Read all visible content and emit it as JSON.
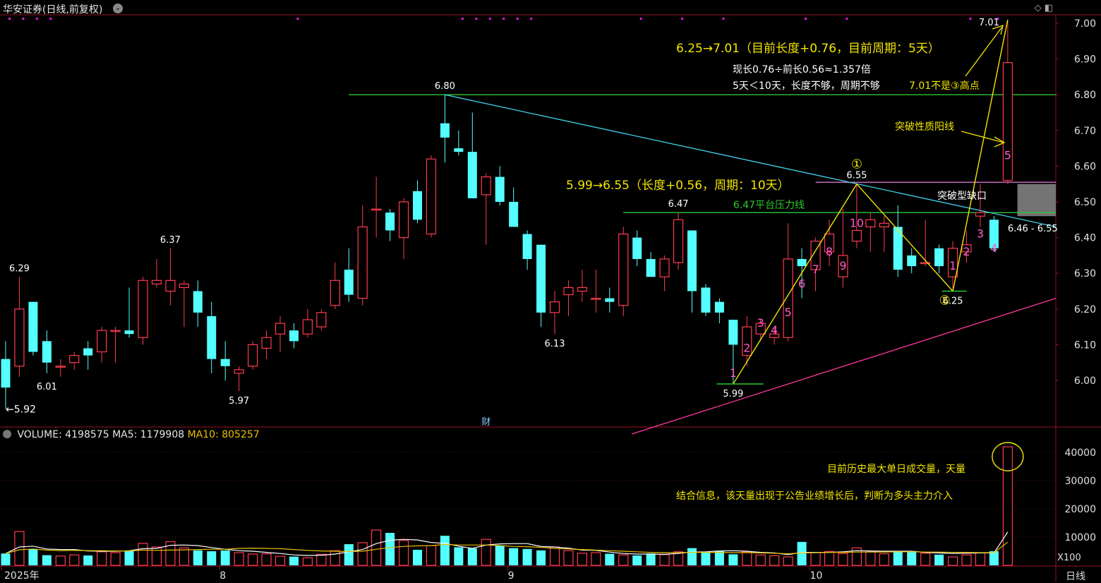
{
  "header": {
    "title": "华安证券(日线,前复权)",
    "menu_icon": "chevron-down-icon",
    "window_icons": [
      "diamond-icon",
      "panel-icon"
    ]
  },
  "colors": {
    "up": "#ff3b52",
    "down": "#54ffff",
    "axis": "#9a0f24",
    "price_label": "#ffffff",
    "annotation_yellow": "#f2e600",
    "count_pink": "#ff5cc8",
    "green_line": "#2ec82e",
    "cyan_line": "#3fd2ec",
    "magenta_line": "#ff3a9c"
  },
  "chart_data": [
    {
      "type": "candlestick",
      "title": "华安证券(日线,前复权)",
      "ylim": [
        5.86,
        7.04
      ],
      "y_ticks": [
        6.0,
        6.1,
        6.2,
        6.3,
        6.4,
        6.5,
        6.6,
        6.7,
        6.8,
        6.9,
        7.0
      ],
      "x_labels": [
        "2025年",
        "8",
        "9",
        "10"
      ],
      "candles": [
        {
          "o": 6.06,
          "h": 6.11,
          "l": 5.92,
          "c": 5.98
        },
        {
          "o": 6.04,
          "h": 6.29,
          "l": 6.01,
          "c": 6.2
        },
        {
          "o": 6.22,
          "h": 6.22,
          "l": 6.07,
          "c": 6.08
        },
        {
          "o": 6.11,
          "h": 6.14,
          "l": 6.02,
          "c": 6.05
        },
        {
          "o": 6.04,
          "h": 6.06,
          "l": 6.01,
          "c": 6.04
        },
        {
          "o": 6.05,
          "h": 6.08,
          "l": 6.03,
          "c": 6.07
        },
        {
          "o": 6.09,
          "h": 6.11,
          "l": 6.03,
          "c": 6.07
        },
        {
          "o": 6.08,
          "h": 6.15,
          "l": 6.05,
          "c": 6.14
        },
        {
          "o": 6.14,
          "h": 6.15,
          "l": 6.05,
          "c": 6.14
        },
        {
          "o": 6.14,
          "h": 6.26,
          "l": 6.12,
          "c": 6.13
        },
        {
          "o": 6.12,
          "h": 6.29,
          "l": 6.1,
          "c": 6.28
        },
        {
          "o": 6.27,
          "h": 6.34,
          "l": 6.26,
          "c": 6.28
        },
        {
          "o": 6.25,
          "h": 6.37,
          "l": 6.21,
          "c": 6.28
        },
        {
          "o": 6.26,
          "h": 6.28,
          "l": 6.15,
          "c": 6.27
        },
        {
          "o": 6.25,
          "h": 6.28,
          "l": 6.15,
          "c": 6.19
        },
        {
          "o": 6.18,
          "h": 6.22,
          "l": 6.02,
          "c": 6.06
        },
        {
          "o": 6.06,
          "h": 6.11,
          "l": 6.0,
          "c": 6.04
        },
        {
          "o": 6.02,
          "h": 6.04,
          "l": 5.97,
          "c": 6.03
        },
        {
          "o": 6.04,
          "h": 6.11,
          "l": 6.03,
          "c": 6.1
        },
        {
          "o": 6.09,
          "h": 6.14,
          "l": 6.06,
          "c": 6.12
        },
        {
          "o": 6.13,
          "h": 6.18,
          "l": 6.08,
          "c": 6.16
        },
        {
          "o": 6.14,
          "h": 6.16,
          "l": 6.09,
          "c": 6.11
        },
        {
          "o": 6.13,
          "h": 6.2,
          "l": 6.12,
          "c": 6.17
        },
        {
          "o": 6.15,
          "h": 6.2,
          "l": 6.14,
          "c": 6.19
        },
        {
          "o": 6.21,
          "h": 6.33,
          "l": 6.2,
          "c": 6.28
        },
        {
          "o": 6.31,
          "h": 6.37,
          "l": 6.22,
          "c": 6.24
        },
        {
          "o": 6.23,
          "h": 6.49,
          "l": 6.21,
          "c": 6.43
        },
        {
          "o": 6.48,
          "h": 6.57,
          "l": 6.4,
          "c": 6.48
        },
        {
          "o": 6.47,
          "h": 6.48,
          "l": 6.39,
          "c": 6.42
        },
        {
          "o": 6.4,
          "h": 6.51,
          "l": 6.34,
          "c": 6.5
        },
        {
          "o": 6.53,
          "h": 6.56,
          "l": 6.44,
          "c": 6.45
        },
        {
          "o": 6.41,
          "h": 6.63,
          "l": 6.4,
          "c": 6.62
        },
        {
          "o": 6.72,
          "h": 6.8,
          "l": 6.61,
          "c": 6.68
        },
        {
          "o": 6.65,
          "h": 6.7,
          "l": 6.63,
          "c": 6.64
        },
        {
          "o": 6.64,
          "h": 6.75,
          "l": 6.51,
          "c": 6.51
        },
        {
          "o": 6.52,
          "h": 6.58,
          "l": 6.38,
          "c": 6.57
        },
        {
          "o": 6.57,
          "h": 6.6,
          "l": 6.49,
          "c": 6.5
        },
        {
          "o": 6.5,
          "h": 6.54,
          "l": 6.43,
          "c": 6.43
        },
        {
          "o": 6.41,
          "h": 6.42,
          "l": 6.31,
          "c": 6.34
        },
        {
          "o": 6.38,
          "h": 6.38,
          "l": 6.15,
          "c": 6.19
        },
        {
          "o": 6.19,
          "h": 6.25,
          "l": 6.13,
          "c": 6.22
        },
        {
          "o": 6.24,
          "h": 6.28,
          "l": 6.18,
          "c": 6.26
        },
        {
          "o": 6.25,
          "h": 6.31,
          "l": 6.22,
          "c": 6.26
        },
        {
          "o": 6.23,
          "h": 6.31,
          "l": 6.19,
          "c": 6.23
        },
        {
          "o": 6.23,
          "h": 6.26,
          "l": 6.19,
          "c": 6.22
        },
        {
          "o": 6.21,
          "h": 6.43,
          "l": 6.18,
          "c": 6.41
        },
        {
          "o": 6.4,
          "h": 6.42,
          "l": 6.32,
          "c": 6.34
        },
        {
          "o": 6.34,
          "h": 6.36,
          "l": 6.29,
          "c": 6.29
        },
        {
          "o": 6.29,
          "h": 6.35,
          "l": 6.25,
          "c": 6.34
        },
        {
          "o": 6.33,
          "h": 6.47,
          "l": 6.31,
          "c": 6.45
        },
        {
          "o": 6.42,
          "h": 6.42,
          "l": 6.19,
          "c": 6.25
        },
        {
          "o": 6.26,
          "h": 6.27,
          "l": 6.18,
          "c": 6.19
        },
        {
          "o": 6.22,
          "h": 6.23,
          "l": 6.16,
          "c": 6.19
        },
        {
          "o": 6.17,
          "h": 6.17,
          "l": 5.99,
          "c": 6.1
        },
        {
          "o": 6.07,
          "h": 6.18,
          "l": 6.04,
          "c": 6.15
        },
        {
          "o": 6.13,
          "h": 6.17,
          "l": 6.11,
          "c": 6.16
        },
        {
          "o": 6.12,
          "h": 6.15,
          "l": 6.1,
          "c": 6.13
        },
        {
          "o": 6.12,
          "h": 6.44,
          "l": 6.11,
          "c": 6.34
        },
        {
          "o": 6.34,
          "h": 6.37,
          "l": 6.23,
          "c": 6.32
        },
        {
          "o": 6.31,
          "h": 6.4,
          "l": 6.25,
          "c": 6.39
        },
        {
          "o": 6.36,
          "h": 6.45,
          "l": 6.32,
          "c": 6.41
        },
        {
          "o": 6.29,
          "h": 6.48,
          "l": 6.26,
          "c": 6.35
        },
        {
          "o": 6.39,
          "h": 6.55,
          "l": 6.37,
          "c": 6.42
        },
        {
          "o": 6.43,
          "h": 6.47,
          "l": 6.36,
          "c": 6.45
        },
        {
          "o": 6.43,
          "h": 6.46,
          "l": 6.36,
          "c": 6.44
        },
        {
          "o": 6.43,
          "h": 6.49,
          "l": 6.29,
          "c": 6.31
        },
        {
          "o": 6.35,
          "h": 6.37,
          "l": 6.3,
          "c": 6.32
        },
        {
          "o": 6.33,
          "h": 6.45,
          "l": 6.32,
          "c": 6.33
        },
        {
          "o": 6.37,
          "h": 6.38,
          "l": 6.3,
          "c": 6.32
        },
        {
          "o": 6.29,
          "h": 6.39,
          "l": 6.25,
          "c": 6.37
        },
        {
          "o": 6.36,
          "h": 6.42,
          "l": 6.33,
          "c": 6.38
        },
        {
          "o": 6.46,
          "h": 6.55,
          "l": 6.43,
          "c": 6.47
        },
        {
          "o": 6.45,
          "h": 6.46,
          "l": 6.36,
          "c": 6.37
        },
        {
          "o": 6.56,
          "h": 7.01,
          "l": 6.55,
          "c": 6.89
        }
      ],
      "price_labels": [
        {
          "text": "6.29",
          "i": 1,
          "v": 6.29,
          "pos": "above"
        },
        {
          "text": "←5.92",
          "i": 0,
          "v": 5.92,
          "pos": "right"
        },
        {
          "text": "6.01",
          "i": 3,
          "v": 6.01,
          "pos": "below"
        },
        {
          "text": "6.37",
          "i": 12,
          "v": 6.37,
          "pos": "above"
        },
        {
          "text": "5.97",
          "i": 17,
          "v": 5.97,
          "pos": "below"
        },
        {
          "text": "6.80",
          "i": 32,
          "v": 6.8,
          "pos": "above"
        },
        {
          "text": "6.13",
          "i": 40,
          "v": 6.13,
          "pos": "below"
        },
        {
          "text": "6.47",
          "i": 49,
          "v": 6.47,
          "pos": "above"
        },
        {
          "text": "5.99",
          "i": 53,
          "v": 5.99,
          "pos": "below"
        },
        {
          "text": "6.55",
          "i": 62,
          "v": 6.55,
          "pos": "above"
        },
        {
          "text": "6.25",
          "i": 69,
          "v": 6.25,
          "pos": "below"
        },
        {
          "text": "7.01",
          "i": 73,
          "v": 7.01,
          "pos": "left"
        }
      ],
      "count_labels": [
        {
          "text": "1",
          "i": 53,
          "v": 6.01
        },
        {
          "text": "2",
          "i": 54,
          "v": 6.08
        },
        {
          "text": "3",
          "i": 55,
          "v": 6.15
        },
        {
          "text": "4",
          "i": 56,
          "v": 6.13
        },
        {
          "text": "5",
          "i": 57,
          "v": 6.18
        },
        {
          "text": "6",
          "i": 58,
          "v": 6.26
        },
        {
          "text": "7",
          "i": 59,
          "v": 6.3
        },
        {
          "text": "8",
          "i": 60,
          "v": 6.35
        },
        {
          "text": "9",
          "i": 61,
          "v": 6.31
        },
        {
          "text": "10",
          "i": 62,
          "v": 6.43
        },
        {
          "text": "1",
          "i": 69,
          "v": 6.31
        },
        {
          "text": "2",
          "i": 70,
          "v": 6.35
        },
        {
          "text": "3",
          "i": 71,
          "v": 6.4
        },
        {
          "text": "4",
          "i": 72,
          "v": 6.36
        },
        {
          "text": "5",
          "i": 73,
          "v": 6.62
        }
      ],
      "lines": {
        "resistance_680": {
          "v": 6.8,
          "from_i": 25,
          "to_i": 78
        },
        "platform_647": {
          "v": 6.47,
          "from_i": 45,
          "to_i": 78,
          "label": "6.47平台压力线"
        },
        "gap_top": {
          "v": 6.555,
          "from_i": 59,
          "to_i": 78
        },
        "downtrend": [
          {
            "i": 32,
            "v": 6.8
          },
          {
            "i": 78,
            "v": 6.43
          }
        ],
        "uptrend": [
          {
            "i": 45,
            "v": 5.85
          },
          {
            "i": 78,
            "v": 6.23
          }
        ],
        "wave": [
          {
            "i": 53,
            "v": 5.99
          },
          {
            "i": 62,
            "v": 6.55
          },
          {
            "i": 69,
            "v": 6.25
          },
          {
            "i": 73,
            "v": 7.01
          }
        ]
      },
      "gap_box": {
        "from_i": 73.5,
        "to_i": 78,
        "low": 6.46,
        "high": 6.55,
        "label": "突破型缺口",
        "range_label": "6.46 - 6.55"
      },
      "annotations": {
        "wave1_title": "6.25→7.01（目前长度+0.76，目前周期：5天）",
        "wave1_line1": "现长0.76÷前长0.56≈1.357倍",
        "wave1_line2": "5天＜10天，长度不够，周期不够",
        "wave1_line3": "7.01不是③高点",
        "breakout": "突破性质阳线",
        "wave0_title": "5.99→6.55（长度+0.56，周期：10天）",
        "circled_1": "①",
        "circled_2": "②",
        "cai": "财"
      }
    },
    {
      "type": "bar",
      "title": "VOLUME",
      "ylim": [
        0,
        43000
      ],
      "y_ticks": [
        10000,
        20000,
        30000,
        40000
      ],
      "unit_label": "X100",
      "volume_label": "VOLUME: 4198575",
      "ma5_label": "MA5: 1179908",
      "ma10_label": "MA10: 805257",
      "values": [
        4200,
        12000,
        5800,
        3600,
        3300,
        3700,
        3500,
        4800,
        4500,
        5000,
        7800,
        6500,
        8400,
        6200,
        5300,
        5000,
        5300,
        4500,
        4000,
        4100,
        3200,
        3100,
        2700,
        3900,
        5200,
        7500,
        8000,
        12500,
        11500,
        8800,
        5500,
        7000,
        10500,
        6400,
        6000,
        9200,
        7000,
        6100,
        5800,
        5300,
        6500,
        5200,
        4300,
        4500,
        4100,
        3700,
        3500,
        4200,
        3800,
        4800,
        6100,
        4500,
        5100,
        3900,
        4800,
        3700,
        3400,
        3000,
        8300,
        4600,
        4900,
        4200,
        6200,
        4800,
        4100,
        5000,
        4700,
        4300,
        3800,
        3000,
        3700,
        4400,
        5000,
        41986
      ],
      "ma5": [
        4200,
        6500,
        6800,
        5800,
        5600,
        5600,
        5100,
        5000,
        5000,
        5200,
        5900,
        6000,
        7100,
        7200,
        7000,
        6300,
        5700,
        5200,
        5000,
        4600,
        4200,
        3700,
        3500,
        3600,
        4000,
        4800,
        5600,
        7700,
        8900,
        9200,
        9000,
        8100,
        7800,
        6800,
        6000,
        7200,
        7600,
        7700,
        7700,
        6700,
        6500,
        6100,
        5400,
        5300,
        4700,
        4200,
        4000,
        4000,
        3900,
        4200,
        4700,
        4800,
        5100,
        5200,
        5000,
        4600,
        4400,
        3800,
        4600,
        4600,
        4600,
        4800,
        5200,
        5100,
        5000,
        5000,
        5000,
        4600,
        4400,
        4200,
        4300,
        4400,
        4400,
        11800
      ],
      "ma10": [
        4200,
        5500,
        5800,
        5400,
        5200,
        5300,
        5200,
        5200,
        5100,
        5100,
        5400,
        5300,
        5400,
        5500,
        5600,
        5700,
        5700,
        6000,
        6100,
        6000,
        5900,
        5600,
        5300,
        5100,
        5000,
        4900,
        5000,
        5700,
        6300,
        6700,
        6900,
        7000,
        7400,
        7200,
        7200,
        7200,
        7000,
        6700,
        6600,
        6400,
        6000,
        5800,
        5600,
        5400,
        5200,
        5000,
        4800,
        4600,
        4500,
        4500,
        4600,
        4600,
        4600,
        4500,
        4500,
        4400,
        4300,
        4100,
        4400,
        4500,
        4600,
        4600,
        4700,
        4700,
        4700,
        4800,
        4800,
        4700,
        4700,
        4600,
        4600,
        4500,
        4500,
        8200
      ],
      "annotation_line1": "目前历史最大单日成交量，天量",
      "annotation_line2": "结合信息，该天量出现于公告业绩增长后，判断为多头主力介入"
    }
  ],
  "footer": {
    "period_label": "日线"
  }
}
